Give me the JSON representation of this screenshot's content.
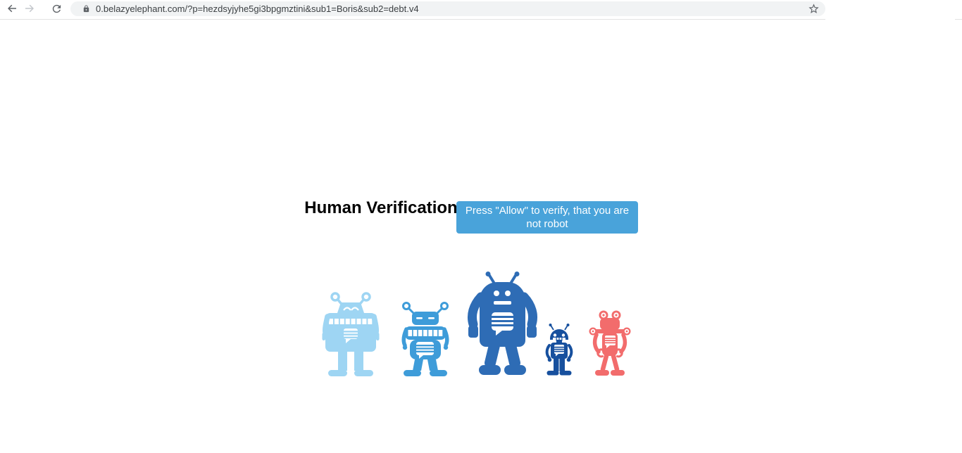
{
  "browser": {
    "toolbar": {
      "back_icon": "arrow-left",
      "forward_icon": "arrow-right",
      "refresh_icon": "reload",
      "security_icon": "padlock",
      "bookmark_icon": "star-outline"
    },
    "address_bar": {
      "url": "0.belazyelephant.com/?p=hezdsyjyhe5gi3bpgmztini&sub1=Boris&sub2=debt.v4"
    }
  },
  "page": {
    "heading": "Human Verification",
    "button": {
      "label": "Press \"Allow\" to verify, that you are not robot",
      "color": "#49a3da"
    },
    "robots": [
      {
        "name": "light-blue-robot",
        "color": "#9ed5f3"
      },
      {
        "name": "blue-robot",
        "color": "#3e9cd9"
      },
      {
        "name": "large-blue-robot",
        "color": "#2e6cb5"
      },
      {
        "name": "navy-robot",
        "color": "#17509e"
      },
      {
        "name": "red-robot",
        "color": "#f26c6c"
      }
    ]
  }
}
